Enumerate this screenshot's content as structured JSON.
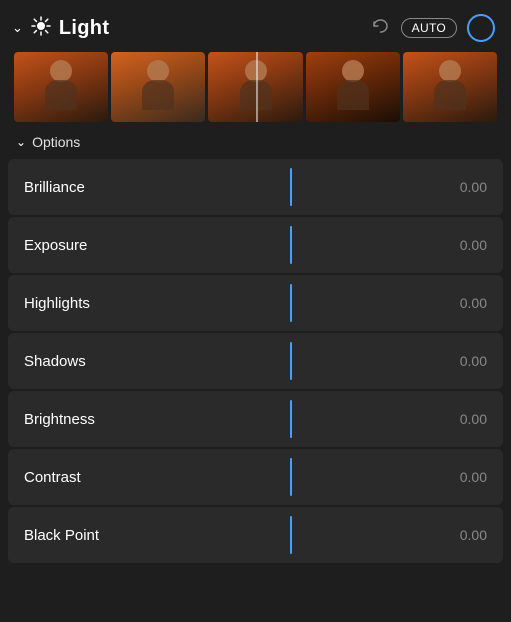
{
  "header": {
    "title": "Light",
    "auto_label": "AUTO",
    "chevron_symbol": "⌄",
    "sun_symbol": "☀"
  },
  "options": {
    "label": "Options",
    "chevron_symbol": "⌄"
  },
  "sliders": [
    {
      "label": "Brilliance",
      "value": "0.00"
    },
    {
      "label": "Exposure",
      "value": "0.00"
    },
    {
      "label": "Highlights",
      "value": "0.00"
    },
    {
      "label": "Shadows",
      "value": "0.00"
    },
    {
      "label": "Brightness",
      "value": "0.00"
    },
    {
      "label": "Contrast",
      "value": "0.00"
    },
    {
      "label": "Black Point",
      "value": "0.00"
    }
  ],
  "colors": {
    "accent": "#4a9eff",
    "background": "#1e1e1e",
    "row_bg": "#2a2a2a",
    "text_primary": "#ffffff",
    "text_secondary": "#888888"
  }
}
